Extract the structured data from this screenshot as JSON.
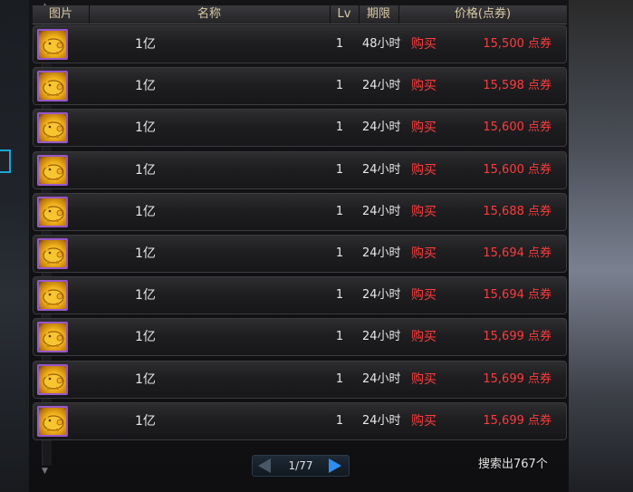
{
  "header": {
    "image": "图片",
    "name": "名称",
    "lv": "Lv",
    "period": "期限",
    "price": "价格(点券)"
  },
  "rows": [
    {
      "name": "1亿",
      "lv": "1",
      "period": "48小时",
      "buy": "购买",
      "price": "15,500 点券"
    },
    {
      "name": "1亿",
      "lv": "1",
      "period": "24小时",
      "buy": "购买",
      "price": "15,598 点券"
    },
    {
      "name": "1亿",
      "lv": "1",
      "period": "24小时",
      "buy": "购买",
      "price": "15,600 点券"
    },
    {
      "name": "1亿",
      "lv": "1",
      "period": "24小时",
      "buy": "购买",
      "price": "15,600 点券"
    },
    {
      "name": "1亿",
      "lv": "1",
      "period": "24小时",
      "buy": "购买",
      "price": "15,688 点券"
    },
    {
      "name": "1亿",
      "lv": "1",
      "period": "24小时",
      "buy": "购买",
      "price": "15,694 点券"
    },
    {
      "name": "1亿",
      "lv": "1",
      "period": "24小时",
      "buy": "购买",
      "price": "15,694 点券"
    },
    {
      "name": "1亿",
      "lv": "1",
      "period": "24小时",
      "buy": "购买",
      "price": "15,699 点券"
    },
    {
      "name": "1亿",
      "lv": "1",
      "period": "24小时",
      "buy": "购买",
      "price": "15,699 点券"
    },
    {
      "name": "1亿",
      "lv": "1",
      "period": "24小时",
      "buy": "购买",
      "price": "15,699 点券"
    }
  ],
  "item_icon": "gold-pig-coin-icon",
  "pager": {
    "text": "1/77"
  },
  "result": "搜索出767个",
  "colors": {
    "price": "#ff3b3b",
    "buy": "#ff3b3b",
    "header_text": "#d9c9a5",
    "next_arrow": "#2f8df0"
  }
}
